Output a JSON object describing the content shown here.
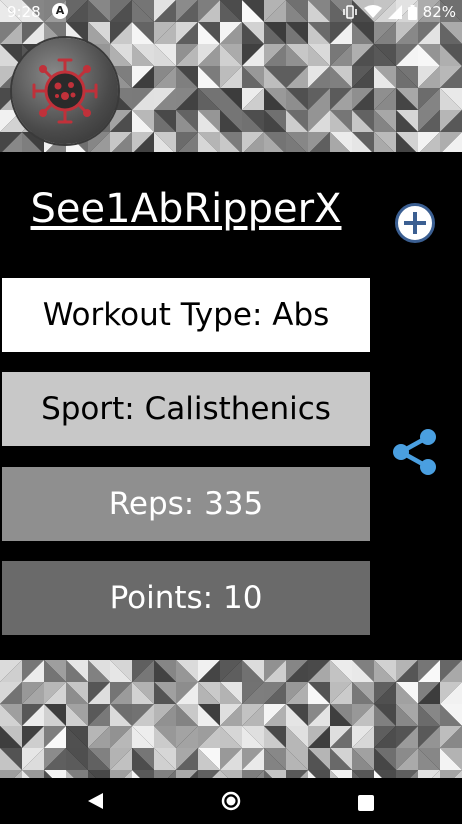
{
  "status_bar": {
    "time": "9:28",
    "battery": "82%",
    "icons": [
      "android-app-icon",
      "vibrate-icon",
      "wifi-icon",
      "signal-icon",
      "battery-icon"
    ]
  },
  "workout": {
    "title": "See1AbRipperX",
    "type_label": "Workout Type: Abs",
    "sport_label": "Sport: Calisthenics",
    "reps_label": "Reps: 335",
    "points_label": "Points: 10"
  },
  "actions": {
    "add_icon": "plus-circle-icon",
    "share_icon": "share-icon",
    "accent_color": "#4a9fe0"
  },
  "navigation": {
    "back_icon": "back-triangle-icon",
    "home_icon": "home-circle-icon",
    "recents_icon": "recents-square-icon"
  },
  "colors": {
    "background": "#000000",
    "logo_virus": "#c0313a"
  }
}
